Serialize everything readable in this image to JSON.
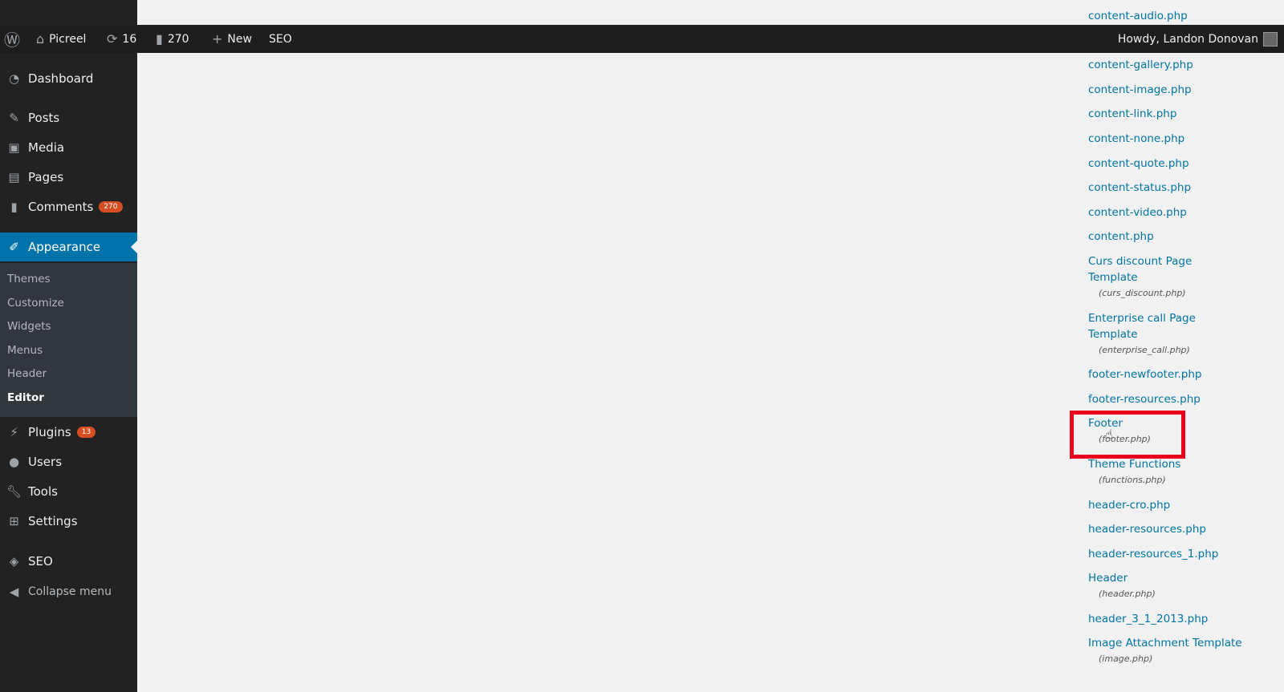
{
  "adminbar": {
    "site": "Picreel",
    "updates": "16",
    "comments": "270",
    "new": "New",
    "seo": "SEO",
    "howdy": "Howdy, Landon Donovan"
  },
  "sidebar": {
    "items": [
      {
        "label": "Dashboard",
        "icon": "dashboard-icon"
      },
      {
        "label": "Posts",
        "icon": "pin-icon"
      },
      {
        "label": "Media",
        "icon": "media-icon"
      },
      {
        "label": "Pages",
        "icon": "pages-icon"
      },
      {
        "label": "Comments",
        "icon": "comment-icon",
        "badge": "270"
      },
      {
        "label": "Appearance",
        "icon": "brush-icon"
      },
      {
        "label": "Plugins",
        "icon": "plugin-icon",
        "badge": "13"
      },
      {
        "label": "Users",
        "icon": "user-icon"
      },
      {
        "label": "Tools",
        "icon": "wrench-icon"
      },
      {
        "label": "Settings",
        "icon": "settings-icon"
      },
      {
        "label": "SEO",
        "icon": "seo-icon"
      },
      {
        "label": "Collapse menu",
        "icon": "collapse-icon"
      }
    ],
    "submenu": [
      "Themes",
      "Customize",
      "Widgets",
      "Menus",
      "Header",
      "Editor"
    ]
  },
  "files": [
    {
      "title": "content-audio.php"
    },
    {
      "title": "content-gallery.php"
    },
    {
      "title": "content-image.php"
    },
    {
      "title": "content-link.php"
    },
    {
      "title": "content-none.php"
    },
    {
      "title": "content-quote.php"
    },
    {
      "title": "content-status.php"
    },
    {
      "title": "content-video.php"
    },
    {
      "title": "content.php"
    },
    {
      "title": "Curs discount Page\nTemplate",
      "file": "(curs_discount.php)"
    },
    {
      "title": "Enterprise call Page\nTemplate",
      "file": "(enterprise_call.php)"
    },
    {
      "title": "footer-newfooter.php"
    },
    {
      "title": "footer-resources.php"
    },
    {
      "title": "Footer",
      "file": "(footer.php)"
    },
    {
      "title": "Theme Functions",
      "file": "(functions.php)"
    },
    {
      "title": "header-cro.php"
    },
    {
      "title": "header-resources.php"
    },
    {
      "title": "header-resources_1.php"
    },
    {
      "title": "Header",
      "file": "(header.php)"
    },
    {
      "title": "header_3_1_2013.php"
    },
    {
      "title": "Image Attachment Template",
      "file": "(image.php)"
    }
  ],
  "highlight_color": "#e8001c"
}
